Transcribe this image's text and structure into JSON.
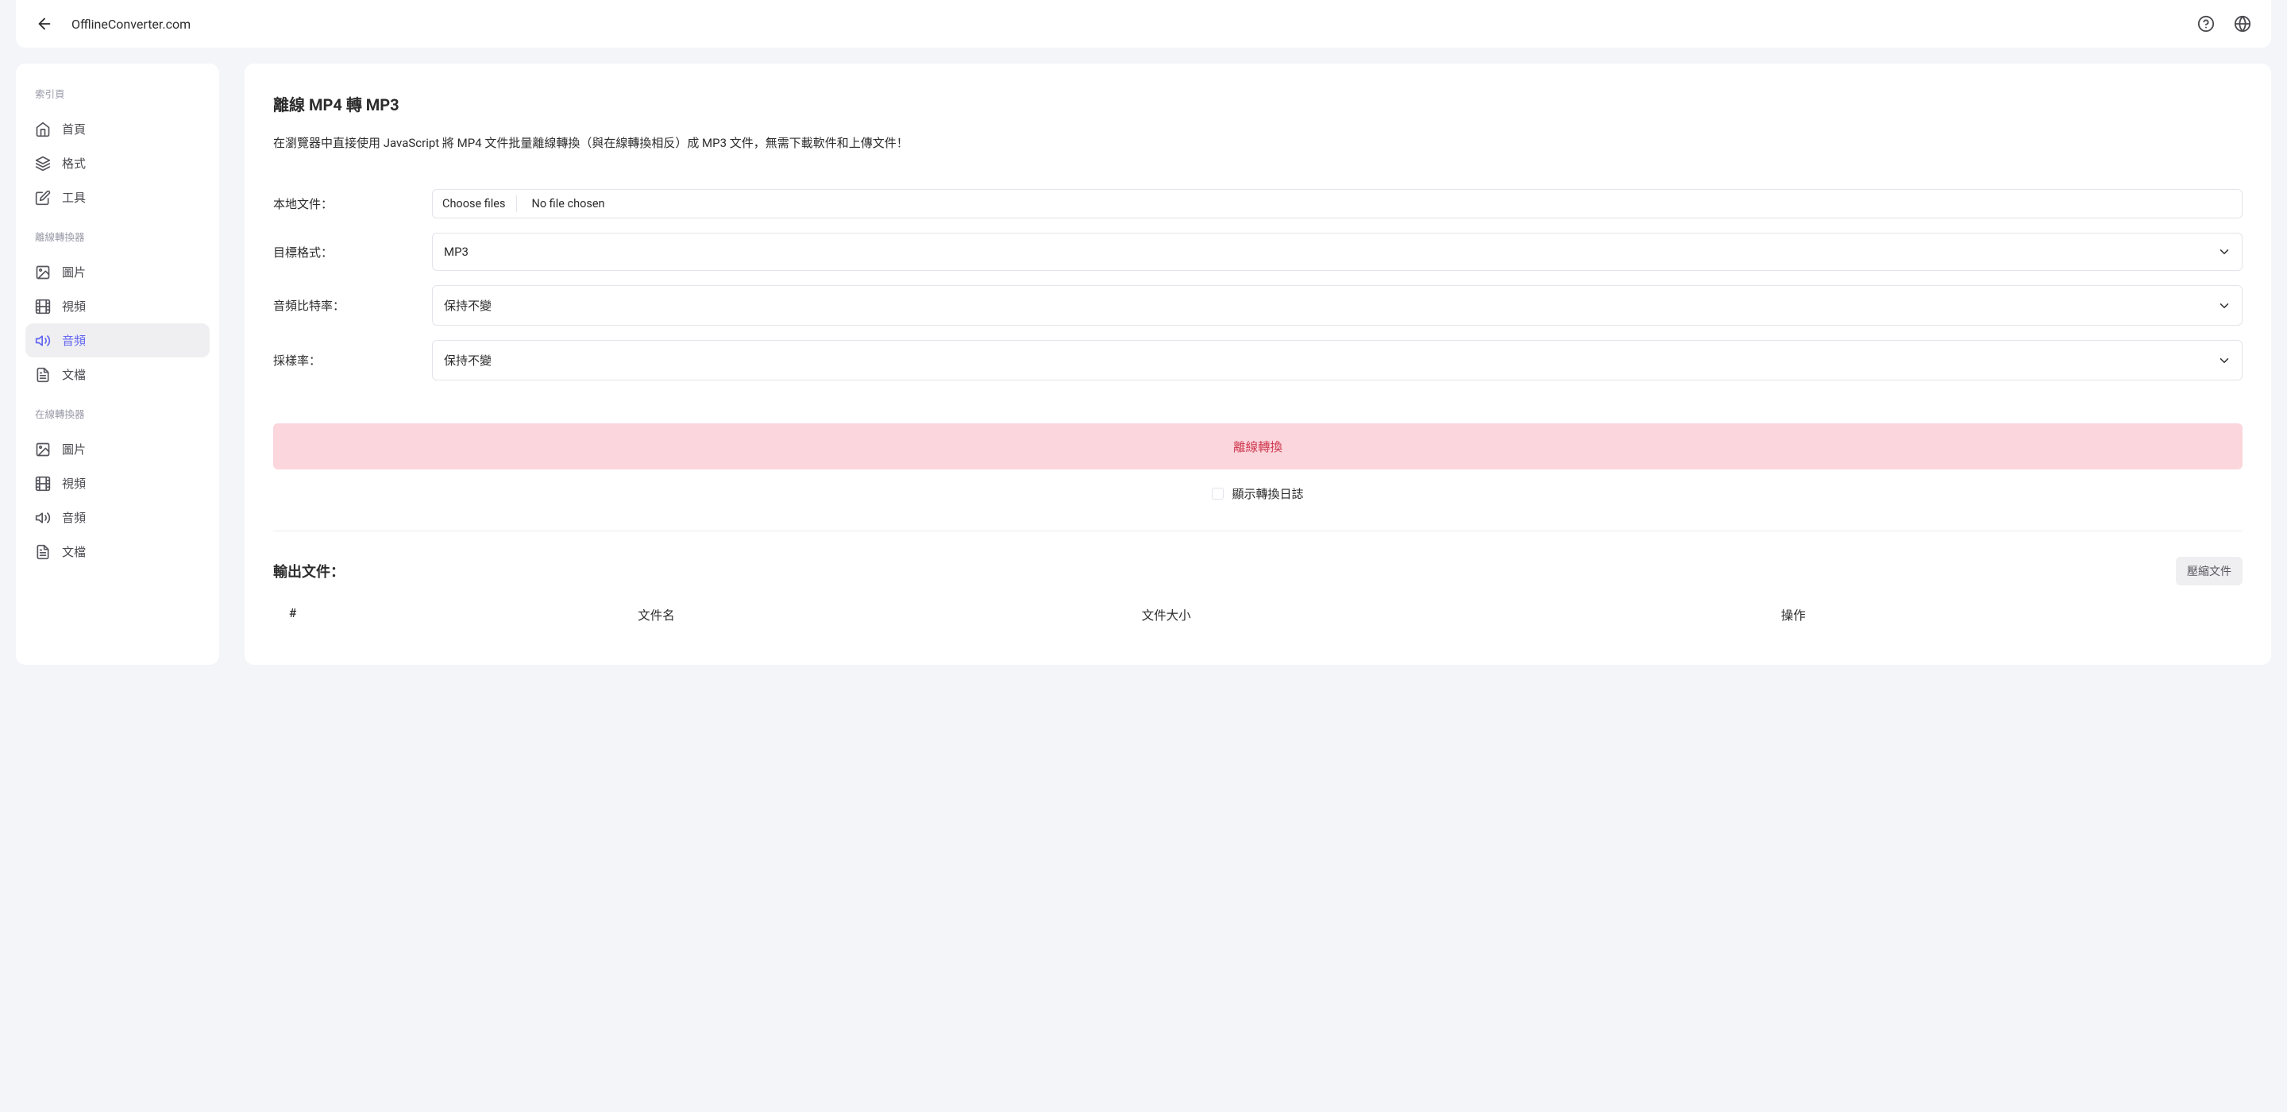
{
  "header": {
    "brand": "OfflineConverter.com"
  },
  "sidebar": {
    "section_index_label": "索引頁",
    "section_offline_label": "離線轉換器",
    "section_online_label": "在線轉換器",
    "items_index": [
      {
        "label": "首頁"
      },
      {
        "label": "格式"
      },
      {
        "label": "工具"
      }
    ],
    "items_offline": [
      {
        "label": "圖片"
      },
      {
        "label": "視頻"
      },
      {
        "label": "音頻"
      },
      {
        "label": "文檔"
      }
    ],
    "items_online": [
      {
        "label": "圖片"
      },
      {
        "label": "視頻"
      },
      {
        "label": "音頻"
      },
      {
        "label": "文檔"
      }
    ]
  },
  "main": {
    "title": "離線 MP4 轉 MP3",
    "description": "在瀏覽器中直接使用 JavaScript 將 MP4 文件批量離線轉換（與在線轉換相反）成 MP3 文件，無需下載軟件和上傳文件！",
    "form": {
      "local_file_label": "本地文件：",
      "choose_files_label": "Choose files",
      "no_file_chosen": "No file chosen",
      "target_format_label": "目標格式：",
      "target_format_value": "MP3",
      "bitrate_label": "音頻比特率：",
      "bitrate_value": "保持不變",
      "samplerate_label": "採樣率：",
      "samplerate_value": "保持不變",
      "convert_button": "離線轉換",
      "show_log_label": "顯示轉換日誌"
    },
    "output": {
      "title": "輸出文件：",
      "compress_button": "壓縮文件",
      "columns": {
        "index": "#",
        "name": "文件名",
        "size": "文件大小",
        "action": "操作"
      }
    }
  }
}
